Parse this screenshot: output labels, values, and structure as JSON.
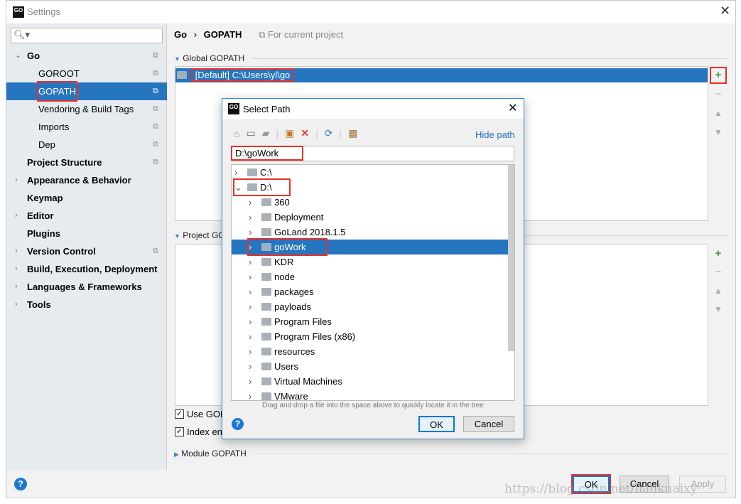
{
  "window": {
    "title": "Settings",
    "app_icon": "GO"
  },
  "search": {
    "placeholder": ""
  },
  "sidebar": {
    "items": [
      {
        "label": "Go",
        "level": 0,
        "expanded": true,
        "bold": true,
        "copy": true
      },
      {
        "label": "GOROOT",
        "level": 1,
        "copy": true
      },
      {
        "label": "GOPATH",
        "level": 1,
        "selected": true,
        "copy": true
      },
      {
        "label": "Vendoring & Build Tags",
        "level": 1,
        "copy": true
      },
      {
        "label": "Imports",
        "level": 1,
        "copy": true
      },
      {
        "label": "Dep",
        "level": 1,
        "copy": true
      },
      {
        "label": "Project Structure",
        "level": 0,
        "bold": true,
        "copy": true
      },
      {
        "label": "Appearance & Behavior",
        "level": 0,
        "bold": true,
        "collapsed": true
      },
      {
        "label": "Keymap",
        "level": 0,
        "bold": true
      },
      {
        "label": "Editor",
        "level": 0,
        "bold": true,
        "collapsed": true
      },
      {
        "label": "Plugins",
        "level": 0,
        "bold": true
      },
      {
        "label": "Version Control",
        "level": 0,
        "bold": true,
        "collapsed": true,
        "copy": true
      },
      {
        "label": "Build, Execution, Deployment",
        "level": 0,
        "bold": true,
        "collapsed": true
      },
      {
        "label": "Languages & Frameworks",
        "level": 0,
        "bold": true,
        "collapsed": true
      },
      {
        "label": "Tools",
        "level": 0,
        "bold": true,
        "collapsed": true
      }
    ]
  },
  "breadcrumb": {
    "parent": "Go",
    "current": "GOPATH",
    "scope": "For current project"
  },
  "global": {
    "title": "Global GOPATH",
    "entries": [
      "[Default] C:\\Users\\yl\\go"
    ]
  },
  "project": {
    "title": "Project GOPATH"
  },
  "options": {
    "use_label": "Use GOPATH",
    "index_label": "Index entire GOPATH",
    "use_checked": true,
    "index_checked": true
  },
  "module": {
    "title": "Module GOPATH"
  },
  "footer": {
    "ok": "OK",
    "cancel": "Cancel",
    "apply": "Apply"
  },
  "dialog": {
    "title": "Select Path",
    "hide_path": "Hide path",
    "path_value": "D:\\goWork",
    "tree": [
      {
        "label": "C:\\",
        "level": 0,
        "expanded": false
      },
      {
        "label": "D:\\",
        "level": 0,
        "expanded": true
      },
      {
        "label": "360",
        "level": 1
      },
      {
        "label": "Deployment",
        "level": 1
      },
      {
        "label": "GoLand 2018.1.5",
        "level": 1
      },
      {
        "label": "goWork",
        "level": 1,
        "selected": true
      },
      {
        "label": "KDR",
        "level": 1
      },
      {
        "label": "node",
        "level": 1
      },
      {
        "label": "packages",
        "level": 1
      },
      {
        "label": "payloads",
        "level": 1
      },
      {
        "label": "Program Files",
        "level": 1
      },
      {
        "label": "Program Files (x86)",
        "level": 1
      },
      {
        "label": "resources",
        "level": 1
      },
      {
        "label": "Users",
        "level": 1
      },
      {
        "label": "Virtual Machines",
        "level": 1
      },
      {
        "label": "VMware",
        "level": 1
      }
    ],
    "hint": "Drag and drop a file into the space above to quickly locate it in the tree",
    "ok": "OK",
    "cancel": "Cancel"
  },
  "watermark": "https://blog.csdn.net/liankuaixy",
  "colors": {
    "selection": "#2675bf",
    "highlight_box": "#e8302a",
    "link": "#2470c9"
  }
}
